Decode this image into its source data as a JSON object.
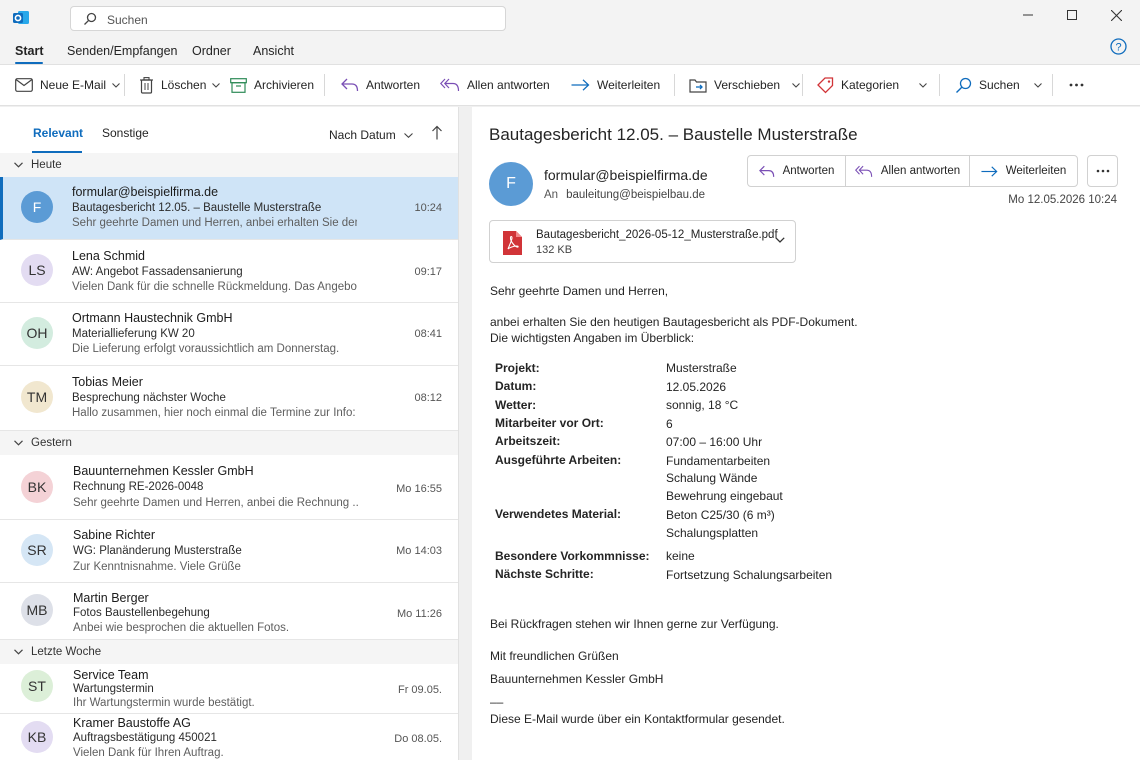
{
  "search": {
    "placeholder": "Suchen"
  },
  "menu": {
    "tabs": [
      "Start",
      "Senden/Empfangen",
      "Ordner",
      "Ansicht"
    ]
  },
  "ribbon": {
    "new_mail": "Neue E-Mail",
    "delete": "Löschen",
    "archive": "Archivieren",
    "reply": "Antworten",
    "reply_all": "Allen antworten",
    "forward": "Weiterleiten",
    "move": "Verschieben",
    "categories": "Kategorien",
    "search": "Suchen"
  },
  "list": {
    "tabs": [
      "Relevant",
      "Sonstige"
    ],
    "sort": "Nach Datum",
    "groups": [
      "Heute",
      "Gestern",
      "Letzte Woche"
    ],
    "messages": [
      {
        "initials": "F",
        "from": "formular@beispielfirma.de",
        "subject": "Bautagesbericht 12.05. – Baustelle Musterstraße",
        "preview": "Sehr geehrte Damen und Herren, anbei erhalten Sie den...",
        "time": "10:24",
        "color": "#5b9bd5"
      },
      {
        "initials": "LS",
        "from": "Lena Schmid",
        "subject": "AW: Angebot Fassadensanierung",
        "preview": "Vielen Dank für die schnelle Rückmeldung. Das Angebot ...",
        "time": "09:17",
        "color": "#e3dcf2"
      },
      {
        "initials": "OH",
        "from": "Ortmann Haustechnik GmbH",
        "subject": "Materiallieferung KW 20",
        "preview": "Die Lieferung erfolgt voraussichtlich am Donnerstag.",
        "time": "08:41",
        "color": "#d3ecdf"
      },
      {
        "initials": "TM",
        "from": "Tobias Meier",
        "subject": "Besprechung nächster Woche",
        "preview": "Hallo zusammen, hier noch einmal die Termine zur Info: ...",
        "time": "08:12",
        "color": "#f1e7cf"
      },
      {
        "initials": "BK",
        "from": "Bauunternehmen Kessler GmbH",
        "subject": "Rechnung RE-2026-0048",
        "preview": "Sehr geehrte Damen und Herren, anbei die Rechnung ...",
        "time": "Mo 16:55",
        "color": "#f4d2d6"
      },
      {
        "initials": "SR",
        "from": "Sabine Richter",
        "subject": "WG: Planänderung Musterstraße",
        "preview": "Zur Kenntnisnahme. Viele Grüße",
        "time": "Mo 14:03",
        "color": "#d5e6f5"
      },
      {
        "initials": "MB",
        "from": "Martin Berger",
        "subject": "Fotos Baustellenbegehung",
        "preview": "Anbei wie besprochen die aktuellen Fotos.",
        "time": "Mo 11:26",
        "color": "#dde0e8"
      },
      {
        "initials": "ST",
        "from": "Service Team",
        "subject": "Wartungstermin",
        "preview": "Ihr Wartungstermin wurde bestätigt.",
        "time": "Fr 09.05.",
        "color": "#dcefd8"
      },
      {
        "initials": "KB",
        "from": "Kramer Baustoffe AG",
        "subject": "Auftragsbestätigung 450021",
        "preview": "Vielen Dank für Ihren Auftrag.",
        "time": "Do 08.05.",
        "color": "#e3dcf2"
      }
    ]
  },
  "reading": {
    "subject": "Bautagesbericht 12.05. – Baustelle Musterstraße",
    "avatar": "F",
    "from": "formular@beispielfirma.de",
    "to_label": "An",
    "to": "bauleitung@beispielbau.de",
    "actions": [
      "Antworten",
      "Allen antworten",
      "Weiterleiten"
    ],
    "date": "Mo 12.05.2026 10:24",
    "attachment": {
      "name": "Bautagesbericht_2026-05-12_Musterstraße.pdf",
      "size": "132 KB"
    },
    "greeting": "Sehr geehrte Damen und Herren,",
    "intro1": "anbei erhalten Sie den heutigen Bautagesbericht als PDF-Dokument.",
    "intro2": "Die wichtigsten Angaben im Überblick:",
    "details": [
      {
        "k": "Projekt:",
        "v": [
          "Musterstraße"
        ]
      },
      {
        "k": "Datum:",
        "v": [
          "12.05.2026"
        ]
      },
      {
        "k": "Wetter:",
        "v": [
          "sonnig, 18 °C"
        ]
      },
      {
        "k": "Mitarbeiter vor Ort:",
        "v": [
          "6"
        ]
      },
      {
        "k": "Arbeitszeit:",
        "v": [
          "07:00 – 16:00 Uhr"
        ]
      },
      {
        "k": "Ausgeführte Arbeiten:",
        "v": [
          "Fundamentarbeiten",
          "Schalung Wände",
          "Bewehrung eingebaut"
        ]
      },
      {
        "k": "Verwendetes Material:",
        "v": [
          "Beton C25/30 (6 m³)",
          "Schalungsplatten"
        ]
      },
      {
        "k": "Besondere Vorkommnisse:",
        "v": [
          "keine"
        ]
      },
      {
        "k": "Nächste Schritte:",
        "v": [
          "Fortsetzung Schalungsarbeiten"
        ]
      }
    ],
    "closing1": "Bei Rückfragen stehen wir Ihnen gerne zur Verfügung.",
    "closing2": "Mit freundlichen Grüßen",
    "signature": "Bauunternehmen Kessler GmbH",
    "sig_sep": "––",
    "footer": "Diese E-Mail wurde über ein Kontaktformular gesendet."
  }
}
